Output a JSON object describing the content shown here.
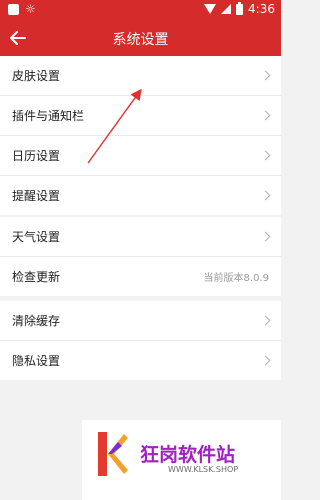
{
  "status_bar": {
    "time": "4:36"
  },
  "header": {
    "title": "系统设置",
    "back_icon": "arrow-left-icon"
  },
  "groups": [
    {
      "items": [
        {
          "label": "皮肤设置",
          "has_chevron": true
        },
        {
          "label": "插件与通知栏",
          "has_chevron": true
        },
        {
          "label": "日历设置",
          "has_chevron": true
        },
        {
          "label": "提醒设置",
          "has_chevron": true
        }
      ]
    },
    {
      "items": [
        {
          "label": "天气设置",
          "has_chevron": true
        },
        {
          "label": "检查更新",
          "value": "当前版本8.0.9"
        }
      ]
    },
    {
      "items": [
        {
          "label": "清除缓存",
          "has_chevron": true
        },
        {
          "label": "隐私设置",
          "has_chevron": true
        }
      ]
    }
  ],
  "watermark": {
    "brand": "狂岗软件站",
    "url": "WWW.KLSK.SHOP"
  },
  "colors": {
    "accent": "#d52b2b",
    "background": "#f2f2f2"
  }
}
